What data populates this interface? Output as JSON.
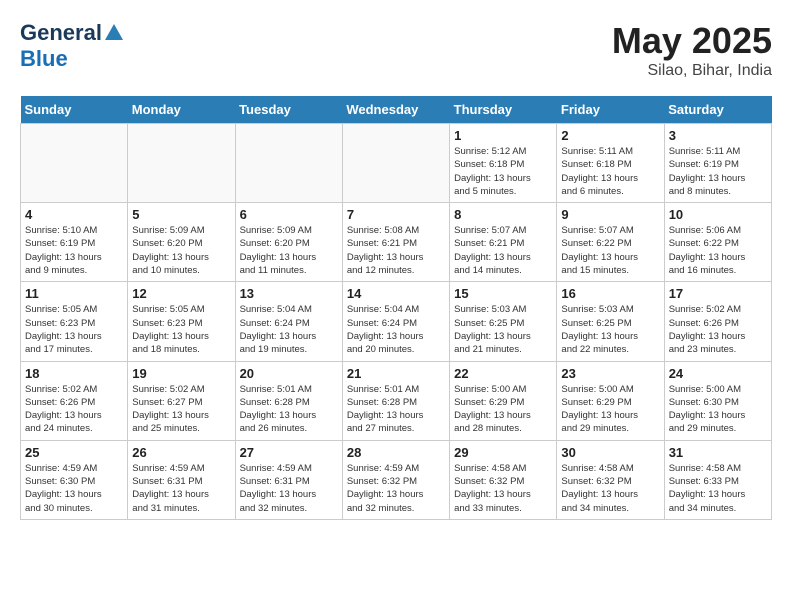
{
  "header": {
    "logo_general": "General",
    "logo_blue": "Blue",
    "title": "May 2025",
    "subtitle": "Silao, Bihar, India"
  },
  "days_of_week": [
    "Sunday",
    "Monday",
    "Tuesday",
    "Wednesday",
    "Thursday",
    "Friday",
    "Saturday"
  ],
  "weeks": [
    [
      {
        "num": "",
        "info": ""
      },
      {
        "num": "",
        "info": ""
      },
      {
        "num": "",
        "info": ""
      },
      {
        "num": "",
        "info": ""
      },
      {
        "num": "1",
        "info": "Sunrise: 5:12 AM\nSunset: 6:18 PM\nDaylight: 13 hours\nand 5 minutes."
      },
      {
        "num": "2",
        "info": "Sunrise: 5:11 AM\nSunset: 6:18 PM\nDaylight: 13 hours\nand 6 minutes."
      },
      {
        "num": "3",
        "info": "Sunrise: 5:11 AM\nSunset: 6:19 PM\nDaylight: 13 hours\nand 8 minutes."
      }
    ],
    [
      {
        "num": "4",
        "info": "Sunrise: 5:10 AM\nSunset: 6:19 PM\nDaylight: 13 hours\nand 9 minutes."
      },
      {
        "num": "5",
        "info": "Sunrise: 5:09 AM\nSunset: 6:20 PM\nDaylight: 13 hours\nand 10 minutes."
      },
      {
        "num": "6",
        "info": "Sunrise: 5:09 AM\nSunset: 6:20 PM\nDaylight: 13 hours\nand 11 minutes."
      },
      {
        "num": "7",
        "info": "Sunrise: 5:08 AM\nSunset: 6:21 PM\nDaylight: 13 hours\nand 12 minutes."
      },
      {
        "num": "8",
        "info": "Sunrise: 5:07 AM\nSunset: 6:21 PM\nDaylight: 13 hours\nand 14 minutes."
      },
      {
        "num": "9",
        "info": "Sunrise: 5:07 AM\nSunset: 6:22 PM\nDaylight: 13 hours\nand 15 minutes."
      },
      {
        "num": "10",
        "info": "Sunrise: 5:06 AM\nSunset: 6:22 PM\nDaylight: 13 hours\nand 16 minutes."
      }
    ],
    [
      {
        "num": "11",
        "info": "Sunrise: 5:05 AM\nSunset: 6:23 PM\nDaylight: 13 hours\nand 17 minutes."
      },
      {
        "num": "12",
        "info": "Sunrise: 5:05 AM\nSunset: 6:23 PM\nDaylight: 13 hours\nand 18 minutes."
      },
      {
        "num": "13",
        "info": "Sunrise: 5:04 AM\nSunset: 6:24 PM\nDaylight: 13 hours\nand 19 minutes."
      },
      {
        "num": "14",
        "info": "Sunrise: 5:04 AM\nSunset: 6:24 PM\nDaylight: 13 hours\nand 20 minutes."
      },
      {
        "num": "15",
        "info": "Sunrise: 5:03 AM\nSunset: 6:25 PM\nDaylight: 13 hours\nand 21 minutes."
      },
      {
        "num": "16",
        "info": "Sunrise: 5:03 AM\nSunset: 6:25 PM\nDaylight: 13 hours\nand 22 minutes."
      },
      {
        "num": "17",
        "info": "Sunrise: 5:02 AM\nSunset: 6:26 PM\nDaylight: 13 hours\nand 23 minutes."
      }
    ],
    [
      {
        "num": "18",
        "info": "Sunrise: 5:02 AM\nSunset: 6:26 PM\nDaylight: 13 hours\nand 24 minutes."
      },
      {
        "num": "19",
        "info": "Sunrise: 5:02 AM\nSunset: 6:27 PM\nDaylight: 13 hours\nand 25 minutes."
      },
      {
        "num": "20",
        "info": "Sunrise: 5:01 AM\nSunset: 6:28 PM\nDaylight: 13 hours\nand 26 minutes."
      },
      {
        "num": "21",
        "info": "Sunrise: 5:01 AM\nSunset: 6:28 PM\nDaylight: 13 hours\nand 27 minutes."
      },
      {
        "num": "22",
        "info": "Sunrise: 5:00 AM\nSunset: 6:29 PM\nDaylight: 13 hours\nand 28 minutes."
      },
      {
        "num": "23",
        "info": "Sunrise: 5:00 AM\nSunset: 6:29 PM\nDaylight: 13 hours\nand 29 minutes."
      },
      {
        "num": "24",
        "info": "Sunrise: 5:00 AM\nSunset: 6:30 PM\nDaylight: 13 hours\nand 29 minutes."
      }
    ],
    [
      {
        "num": "25",
        "info": "Sunrise: 4:59 AM\nSunset: 6:30 PM\nDaylight: 13 hours\nand 30 minutes."
      },
      {
        "num": "26",
        "info": "Sunrise: 4:59 AM\nSunset: 6:31 PM\nDaylight: 13 hours\nand 31 minutes."
      },
      {
        "num": "27",
        "info": "Sunrise: 4:59 AM\nSunset: 6:31 PM\nDaylight: 13 hours\nand 32 minutes."
      },
      {
        "num": "28",
        "info": "Sunrise: 4:59 AM\nSunset: 6:32 PM\nDaylight: 13 hours\nand 32 minutes."
      },
      {
        "num": "29",
        "info": "Sunrise: 4:58 AM\nSunset: 6:32 PM\nDaylight: 13 hours\nand 33 minutes."
      },
      {
        "num": "30",
        "info": "Sunrise: 4:58 AM\nSunset: 6:32 PM\nDaylight: 13 hours\nand 34 minutes."
      },
      {
        "num": "31",
        "info": "Sunrise: 4:58 AM\nSunset: 6:33 PM\nDaylight: 13 hours\nand 34 minutes."
      }
    ]
  ]
}
